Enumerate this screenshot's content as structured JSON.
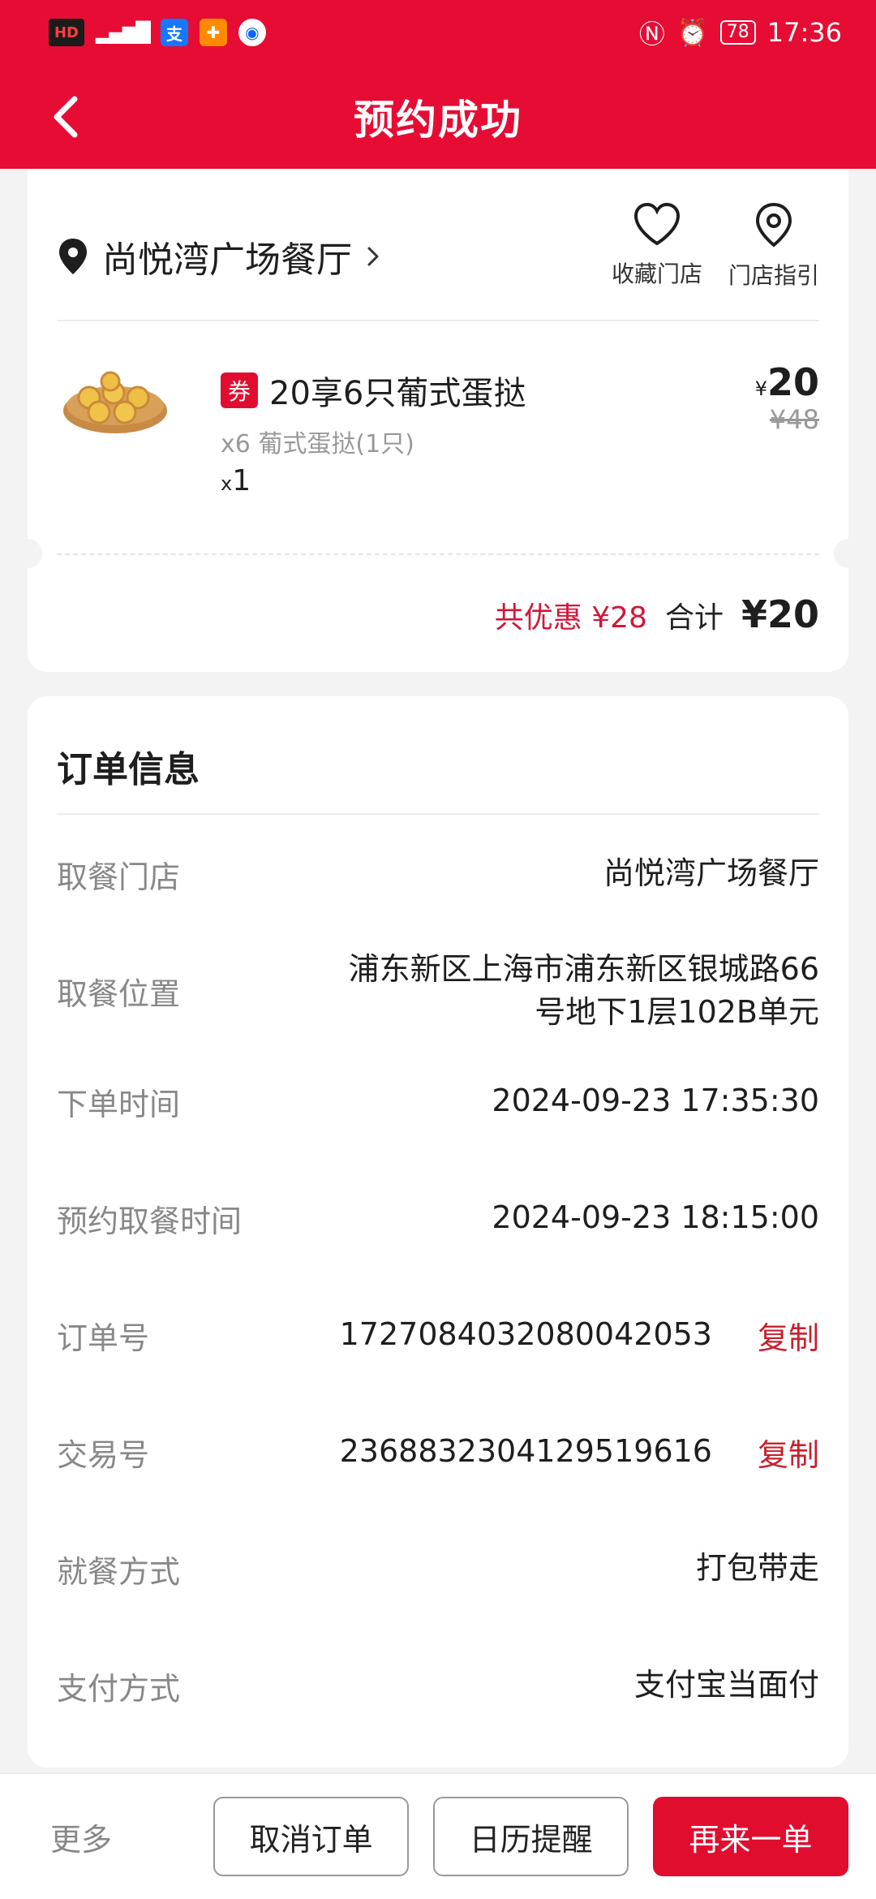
{
  "status_bar": {
    "hd": "HD",
    "network": "4G",
    "time": "17:36",
    "battery": "78"
  },
  "nav": {
    "title": "预约成功"
  },
  "store": {
    "name": "尚悦湾广场餐厅",
    "favorite_label": "收藏门店",
    "guide_label": "门店指引"
  },
  "item": {
    "coupon_badge": "券",
    "title": "20享6只葡式蛋挞",
    "sub": "x6 葡式蛋挞(1只)",
    "qty_prefix": "x",
    "qty": "1",
    "price_symbol": "¥",
    "price": "20",
    "original_price": "¥48"
  },
  "totals": {
    "discount": "共优惠 ¥28",
    "total_label": "合计",
    "total_value": "¥20"
  },
  "order_info": {
    "title": "订单信息",
    "rows": [
      {
        "label": "取餐门店",
        "value": "尚悦湾广场餐厅"
      },
      {
        "label": "取餐位置",
        "value_line1": "浦东新区上海市浦东新区银城路66",
        "value_line2": "号地下1层102B单元"
      },
      {
        "label": "下单时间",
        "value": "2024-09-23 17:35:30"
      },
      {
        "label": "预约取餐时间",
        "value": "2024-09-23 18:15:00"
      },
      {
        "label": "订单号",
        "value": "1727084032080042053",
        "action": "复制"
      },
      {
        "label": "交易号",
        "value": "2368832304129519616",
        "action": "复制"
      },
      {
        "label": "就餐方式",
        "value": "打包带走"
      },
      {
        "label": "支付方式",
        "value": "支付宝当面付"
      }
    ]
  },
  "bottom": {
    "more": "更多",
    "cancel": "取消订单",
    "calendar": "日历提醒",
    "reorder": "再来一单"
  },
  "colors": {
    "brand_red": "#e60c34",
    "copy_red": "#c8202e"
  }
}
